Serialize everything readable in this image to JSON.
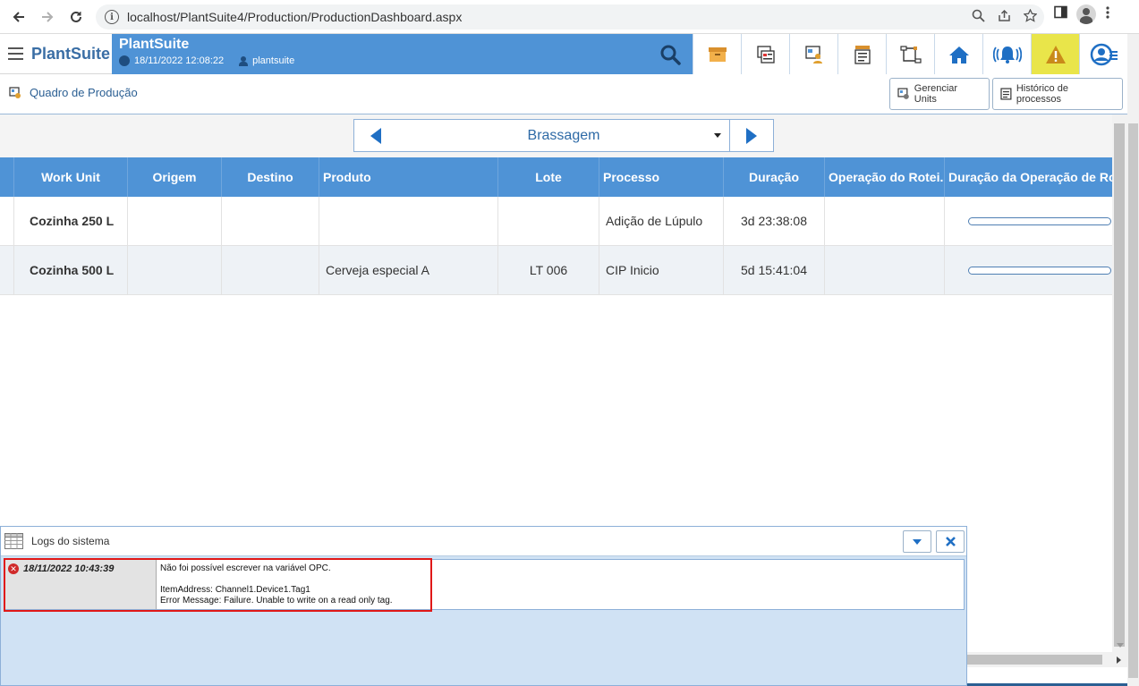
{
  "browser": {
    "url": "localhost/PlantSuite4/Production/ProductionDashboard.aspx"
  },
  "app": {
    "brand": "PlantSuite",
    "title": "PlantSuite",
    "datetime": "18/11/2022 12:08:22",
    "user": "plantsuite"
  },
  "subheader": {
    "page_title": "Quadro de Produção",
    "manage_units_label": "Gerenciar Units",
    "process_history_label": "Histórico de processos"
  },
  "selector": {
    "value": "Brassagem"
  },
  "table": {
    "headers": [
      "Work Unit",
      "Origem",
      "Destino",
      "Produto",
      "Lote",
      "Processo",
      "Duração",
      "Operação do Rotei...",
      "Duração da Operação de Roteiro"
    ],
    "rows": [
      {
        "work_unit": "Cozinha 250 L",
        "origem": "",
        "destino": "",
        "produto": "",
        "lote": "",
        "processo": "Adição de Lúpulo",
        "duracao": "3d 23:38:08",
        "operacao": "",
        "progress": 0
      },
      {
        "work_unit": "Cozinha 500 L",
        "origem": "",
        "destino": "",
        "produto": "Cerveja especial A",
        "lote": "LT 006",
        "processo": "CIP Inicio",
        "duracao": "5d 15:41:04",
        "operacao": "",
        "progress": 0
      }
    ]
  },
  "logs": {
    "title": "Logs do sistema",
    "entries": [
      {
        "timestamp": "18/11/2022 10:43:39",
        "line1": "Não foi possível escrever na variável OPC.",
        "line2": "ItemAddress: Channel1.Device1.Tag1",
        "line3": "Error Message: Failure. Unable to write on a read only tag."
      }
    ]
  },
  "colors": {
    "header_blue": "#4f93d6",
    "warning_yellow": "#e9e54a",
    "error_red": "#d02a2a",
    "highlight_red": "#e01818"
  }
}
